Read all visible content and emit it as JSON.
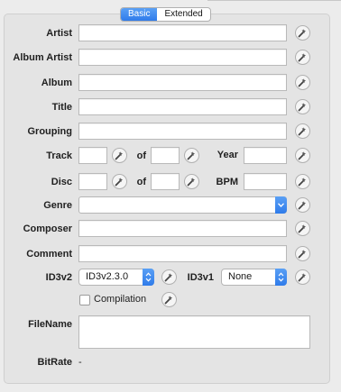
{
  "tabs": {
    "basic": "Basic",
    "extended": "Extended",
    "active": "basic"
  },
  "fields": {
    "artist": {
      "label": "Artist",
      "value": ""
    },
    "album_artist": {
      "label": "Album Artist",
      "value": ""
    },
    "album": {
      "label": "Album",
      "value": ""
    },
    "title": {
      "label": "Title",
      "value": ""
    },
    "grouping": {
      "label": "Grouping",
      "value": ""
    },
    "track": {
      "label": "Track",
      "value": "",
      "of_label": "of",
      "total": ""
    },
    "year": {
      "label": "Year",
      "value": ""
    },
    "disc": {
      "label": "Disc",
      "value": "",
      "of_label": "of",
      "total": ""
    },
    "bpm": {
      "label": "BPM",
      "value": ""
    },
    "genre": {
      "label": "Genre",
      "value": ""
    },
    "composer": {
      "label": "Composer",
      "value": ""
    },
    "comment": {
      "label": "Comment",
      "value": ""
    },
    "id3v2": {
      "label": "ID3v2",
      "selected": "ID3v2.3.0"
    },
    "id3v1": {
      "label": "ID3v1",
      "selected": "None"
    },
    "compilation": {
      "label": "Compilation",
      "checked": false
    },
    "filename": {
      "label": "FileName",
      "value": ""
    },
    "bitrate": {
      "label": "BitRate",
      "value": "-"
    }
  },
  "icons": {
    "wand": "magic-wand-icon",
    "dropdown": "chevron-updown-icon"
  },
  "colors": {
    "accent": "#2f7bea",
    "panel": "#e4e4e4",
    "background": "#ececec"
  }
}
